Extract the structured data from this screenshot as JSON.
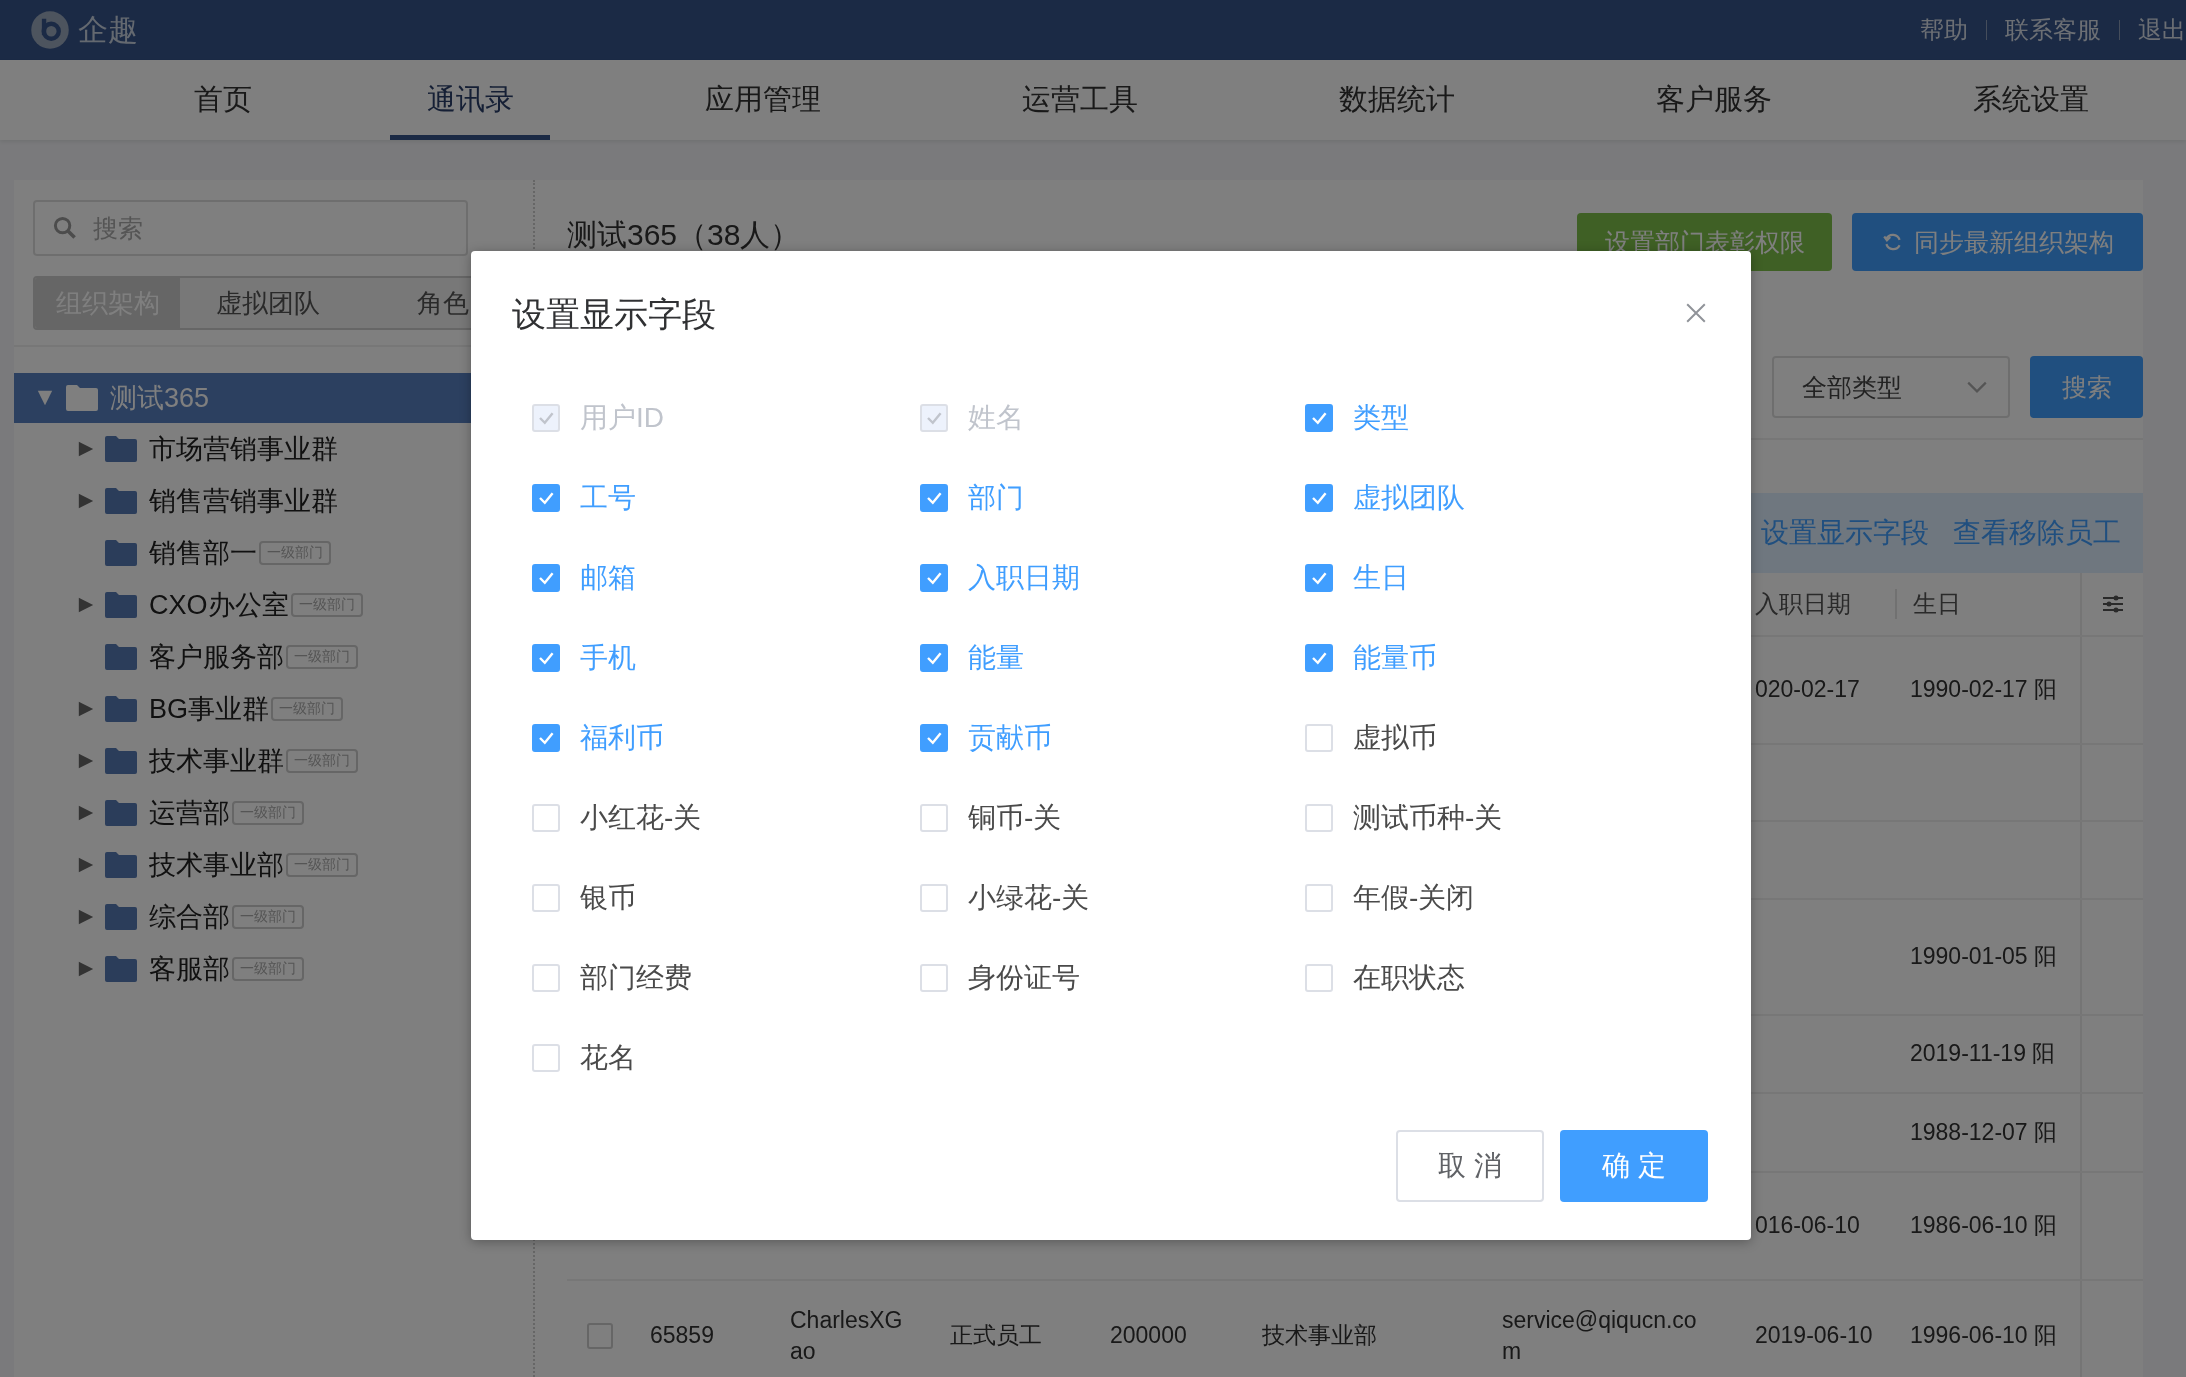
{
  "header": {
    "brand": "企趣",
    "links": [
      "帮助",
      "联系客服",
      "退出"
    ]
  },
  "nav": [
    {
      "label": "首页",
      "selected": false
    },
    {
      "label": "通讯录",
      "selected": true
    },
    {
      "label": "应用管理",
      "selected": false
    },
    {
      "label": "运营工具",
      "selected": false
    },
    {
      "label": "数据统计",
      "selected": false
    },
    {
      "label": "客户服务",
      "selected": false
    },
    {
      "label": "系统设置",
      "selected": false
    }
  ],
  "sidebar": {
    "search": {
      "placeholder": "搜索"
    },
    "tabs": [
      {
        "label": "组织架构",
        "selected": true
      },
      {
        "label": "虚拟团队",
        "selected": false
      },
      {
        "label": "角色",
        "selected": false
      }
    ],
    "tree": [
      {
        "label": "测试365",
        "expanded": true,
        "selected": true,
        "children": [
          {
            "label": "市场营销事业群",
            "has_children": true,
            "selected": false
          },
          {
            "label": "销售营销事业群",
            "has_children": true,
            "selected": false
          },
          {
            "label": "销售部一",
            "badge": "一级部门",
            "has_children": false,
            "selected": false
          },
          {
            "label": "CXO办公室",
            "badge": "一级部门",
            "has_children": true,
            "selected": false
          },
          {
            "label": "客户服务部",
            "badge": "一级部门",
            "has_children": false,
            "selected": false
          },
          {
            "label": "BG事业群",
            "badge": "一级部门",
            "has_children": true,
            "selected": false
          },
          {
            "label": "技术事业群",
            "badge": "一级部门",
            "has_children": true,
            "selected": false
          },
          {
            "label": "运营部",
            "badge": "一级部门",
            "has_children": true,
            "selected": false
          },
          {
            "label": "技术事业部",
            "badge": "一级部门",
            "has_children": true,
            "selected": false
          },
          {
            "label": "综合部",
            "badge": "一级部门",
            "has_children": true,
            "selected": false
          },
          {
            "label": "客服部",
            "badge": "一级部门",
            "has_children": true,
            "selected": false
          }
        ]
      }
    ]
  },
  "main": {
    "title": "测试365（38人）",
    "buttons": [
      {
        "label": "设置部门表彰权限",
        "kind": "green"
      },
      {
        "label": "同步最新组织架构",
        "kind": "sync"
      }
    ],
    "type_filter": {
      "value": "全部类型"
    },
    "search_button": "搜索",
    "toolbar_links": [
      "设置显示字段",
      "查看移除员工"
    ],
    "table": {
      "columns": [
        "入职日期",
        "生日"
      ],
      "rows": [
        {
          "hire_date": "020-02-17",
          "birthday": "1990-02-17 阳"
        },
        {},
        {},
        {
          "birthday": "1990-01-05 阳"
        },
        {
          "birthday": "2019-11-19 阳"
        },
        {
          "birthday": "1988-12-07 阳"
        },
        {
          "hire_date": "016-06-10",
          "birthday": "1986-06-10 阳"
        },
        {
          "checked": false,
          "column_1": "65859",
          "column_2": "CharlesXGao",
          "column_3": "正式员工",
          "column_4": "200000",
          "column_5": "技术事业部",
          "column_6": "service@qiqucn.com",
          "hire_date": "2019-06-10",
          "birthday": "1996-06-10 阳"
        }
      ]
    }
  },
  "dialog": {
    "title": "设置显示字段",
    "fields": [
      {
        "label": "用户ID",
        "checked": true,
        "disabled": true
      },
      {
        "label": "姓名",
        "checked": true,
        "disabled": true
      },
      {
        "label": "类型",
        "checked": true,
        "disabled": false
      },
      {
        "label": "工号",
        "checked": true,
        "disabled": false
      },
      {
        "label": "部门",
        "checked": true,
        "disabled": false
      },
      {
        "label": "虚拟团队",
        "checked": true,
        "disabled": false
      },
      {
        "label": "邮箱",
        "checked": true,
        "disabled": false
      },
      {
        "label": "入职日期",
        "checked": true,
        "disabled": false
      },
      {
        "label": "生日",
        "checked": true,
        "disabled": false
      },
      {
        "label": "手机",
        "checked": true,
        "disabled": false
      },
      {
        "label": "能量",
        "checked": true,
        "disabled": false
      },
      {
        "label": "能量币",
        "checked": true,
        "disabled": false
      },
      {
        "label": "福利币",
        "checked": true,
        "disabled": false
      },
      {
        "label": "贡献币",
        "checked": true,
        "disabled": false
      },
      {
        "label": "虚拟币",
        "checked": false,
        "disabled": false
      },
      {
        "label": "小红花-关",
        "checked": false,
        "disabled": false
      },
      {
        "label": "铜币-关",
        "checked": false,
        "disabled": false
      },
      {
        "label": "测试币种-关",
        "checked": false,
        "disabled": false
      },
      {
        "label": "银币",
        "checked": false,
        "disabled": false
      },
      {
        "label": "小绿花-关",
        "checked": false,
        "disabled": false
      },
      {
        "label": "年假-关闭",
        "checked": false,
        "disabled": false
      },
      {
        "label": "部门经费",
        "checked": false,
        "disabled": false
      },
      {
        "label": "身份证号",
        "checked": false,
        "disabled": false
      },
      {
        "label": "在职状态",
        "checked": false,
        "disabled": false
      },
      {
        "label": "花名",
        "checked": false,
        "disabled": false
      }
    ],
    "buttons": [
      "取 消",
      "确 定"
    ]
  }
}
